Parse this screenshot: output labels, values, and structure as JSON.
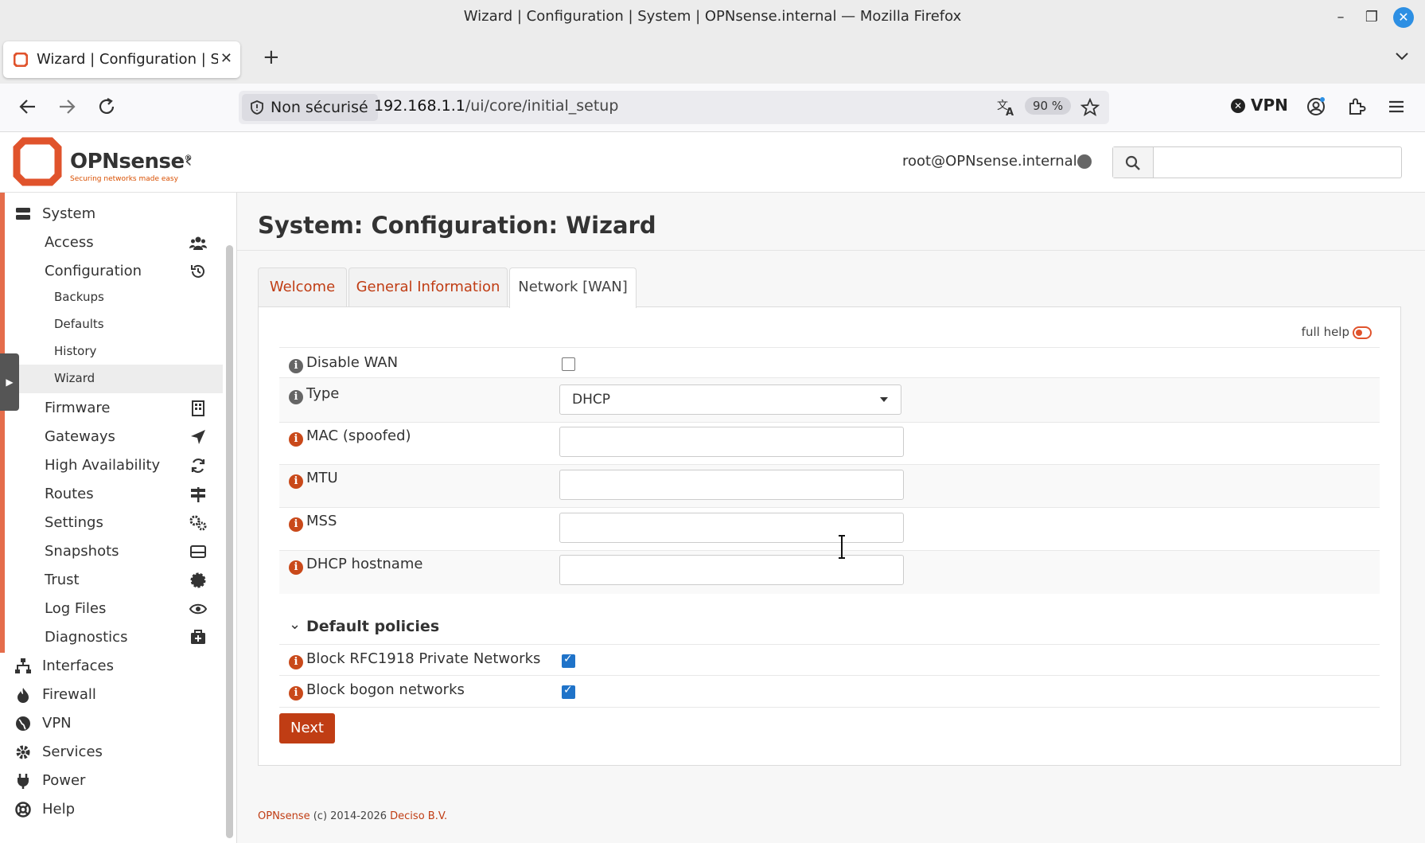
{
  "window": {
    "title": "Wizard | Configuration | System | OPNsense.internal — Mozilla Firefox"
  },
  "browser": {
    "tab_label": "Wizard | Configuration | System",
    "security_label": "Non sécurisé",
    "url_host": "192.168.1.1",
    "url_path": "/ui/core/initial_setup",
    "zoom": "90 %",
    "vpn_label": "VPN"
  },
  "header": {
    "brand": "OPNsense",
    "brand_mark": "®",
    "tagline": "Securing networks made easy",
    "user": "root@OPNsense.internal",
    "search_placeholder": ""
  },
  "sidebar": {
    "system": "System",
    "items": [
      {
        "label": "Access",
        "icon": "users-icon"
      },
      {
        "label": "Configuration",
        "icon": "history-icon"
      },
      {
        "label": "Backups"
      },
      {
        "label": "Defaults"
      },
      {
        "label": "History"
      },
      {
        "label": "Wizard"
      },
      {
        "label": "Firmware",
        "icon": "building-icon"
      },
      {
        "label": "Gateways",
        "icon": "location-arrow-icon"
      },
      {
        "label": "High Availability",
        "icon": "refresh-icon"
      },
      {
        "label": "Routes",
        "icon": "signs-icon"
      },
      {
        "label": "Settings",
        "icon": "gears-icon"
      },
      {
        "label": "Snapshots",
        "icon": "hdd-icon"
      },
      {
        "label": "Trust",
        "icon": "certificate-icon"
      },
      {
        "label": "Log Files",
        "icon": "eye-icon"
      },
      {
        "label": "Diagnostics",
        "icon": "medkit-icon"
      }
    ],
    "top": [
      {
        "label": "Interfaces",
        "icon": "sitemap-icon"
      },
      {
        "label": "Firewall",
        "icon": "fire-icon"
      },
      {
        "label": "VPN",
        "icon": "globe-icon"
      },
      {
        "label": "Services",
        "icon": "cog-icon"
      },
      {
        "label": "Power",
        "icon": "plug-icon"
      },
      {
        "label": "Help",
        "icon": "life-ring-icon"
      }
    ]
  },
  "page": {
    "title": "System: Configuration: Wizard",
    "tabs": [
      "Welcome",
      "General Information",
      "Network [WAN]"
    ],
    "full_help": "full help",
    "fields": {
      "disable_wan": "Disable WAN",
      "type": "Type",
      "type_value": "DHCP",
      "mac": "MAC (spoofed)",
      "mtu": "MTU",
      "mss": "MSS",
      "dhcp_hostname": "DHCP hostname"
    },
    "section": "Default policies",
    "policies": {
      "rfc1918": "Block RFC1918 Private Networks",
      "bogon": "Block bogon networks"
    },
    "next": "Next"
  },
  "footer": {
    "brand": "OPNsense",
    "copyright": "(c) 2014-2026",
    "company": "Deciso B.V."
  },
  "colors": {
    "accent": "#c03d14",
    "brand_orange": "#e0532c",
    "checkbox_blue": "#1f73c9"
  }
}
